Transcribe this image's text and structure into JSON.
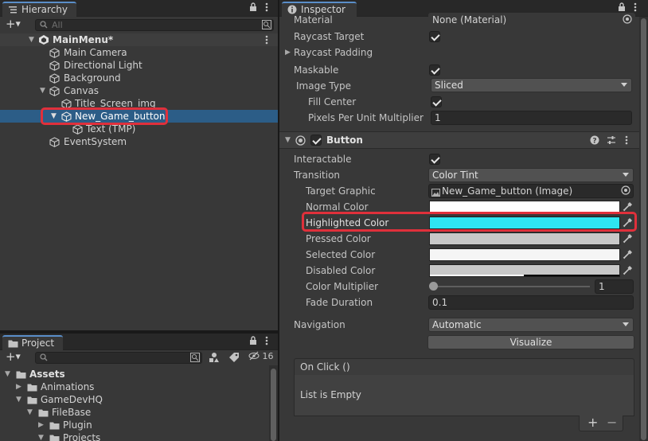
{
  "hierarchy": {
    "tab_label": "Hierarchy",
    "search_placeholder": "All",
    "scene_name": "MainMenu*",
    "items": [
      {
        "label": "Main Camera"
      },
      {
        "label": "Directional Light"
      },
      {
        "label": "Background"
      },
      {
        "label": "Canvas"
      },
      {
        "label": "Title_Screen_img"
      },
      {
        "label": "New_Game_button"
      },
      {
        "label": "Text (TMP)"
      },
      {
        "label": "EventSystem"
      }
    ]
  },
  "project": {
    "tab_label": "Project",
    "hidden_count": "16",
    "items": [
      {
        "label": "Assets"
      },
      {
        "label": "Animations"
      },
      {
        "label": "GameDevHQ"
      },
      {
        "label": "FileBase"
      },
      {
        "label": "Plugin"
      },
      {
        "label": "Projects"
      }
    ]
  },
  "inspector": {
    "tab_label": "Inspector",
    "image": {
      "material_label": "Material",
      "material_value": "None (Material)",
      "raycast_target_label": "Raycast Target",
      "raycast_padding_label": "Raycast Padding",
      "maskable_label": "Maskable",
      "image_type_label": "Image Type",
      "image_type_value": "Sliced",
      "fill_center_label": "Fill Center",
      "ppu_label": "Pixels Per Unit Multiplier",
      "ppu_value": "1"
    },
    "button": {
      "title": "Button",
      "interactable_label": "Interactable",
      "transition_label": "Transition",
      "transition_value": "Color Tint",
      "target_graphic_label": "Target Graphic",
      "target_graphic_value": "New_Game_button (Image)",
      "normal_color_label": "Normal Color",
      "highlighted_color_label": "Highlighted Color",
      "pressed_color_label": "Pressed Color",
      "selected_color_label": "Selected Color",
      "disabled_color_label": "Disabled Color",
      "color_multiplier_label": "Color Multiplier",
      "color_multiplier_value": "1",
      "fade_duration_label": "Fade Duration",
      "fade_duration_value": "0.1",
      "navigation_label": "Navigation",
      "navigation_value": "Automatic",
      "visualize_label": "Visualize",
      "onclick_label": "On Click ()",
      "list_empty_label": "List is Empty",
      "colors": {
        "normal": "#ffffff",
        "highlighted": "#2ee5f2",
        "pressed": "#c8c8c8",
        "selected": "#f5f5f5",
        "disabled": "#c8c8c8"
      }
    }
  },
  "theme": {
    "selection": "#2c5d87",
    "highlight_box": "#e0303b",
    "tab_accent": "#5a8ec9"
  }
}
